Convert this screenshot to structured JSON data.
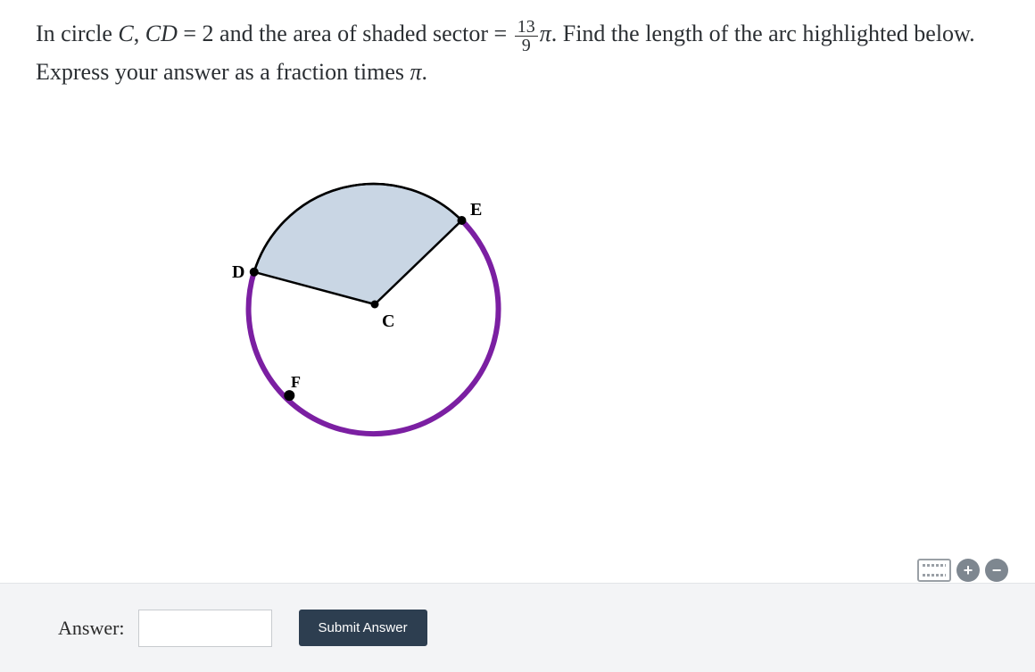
{
  "problem": {
    "text_prefix": "In circle ",
    "var_C": "C",
    "sep1": ", ",
    "var_CD": "CD",
    "eq": " = ",
    "cd_value": "2",
    "mid1": " and the area of shaded sector = ",
    "frac_num": "13",
    "frac_den": "9",
    "pi1": "π",
    "mid2": ". Find the length of the arc highlighted below. Express your answer as a fraction times ",
    "pi2": "π",
    "end": "."
  },
  "figure": {
    "label_C": "C",
    "label_D": "D",
    "label_E": "E",
    "label_F": "F"
  },
  "answer_bar": {
    "label": "Answer:",
    "input_value": "",
    "submit_label": "Submit Answer"
  },
  "toolbar": {
    "plus": "+",
    "minus": "−"
  }
}
